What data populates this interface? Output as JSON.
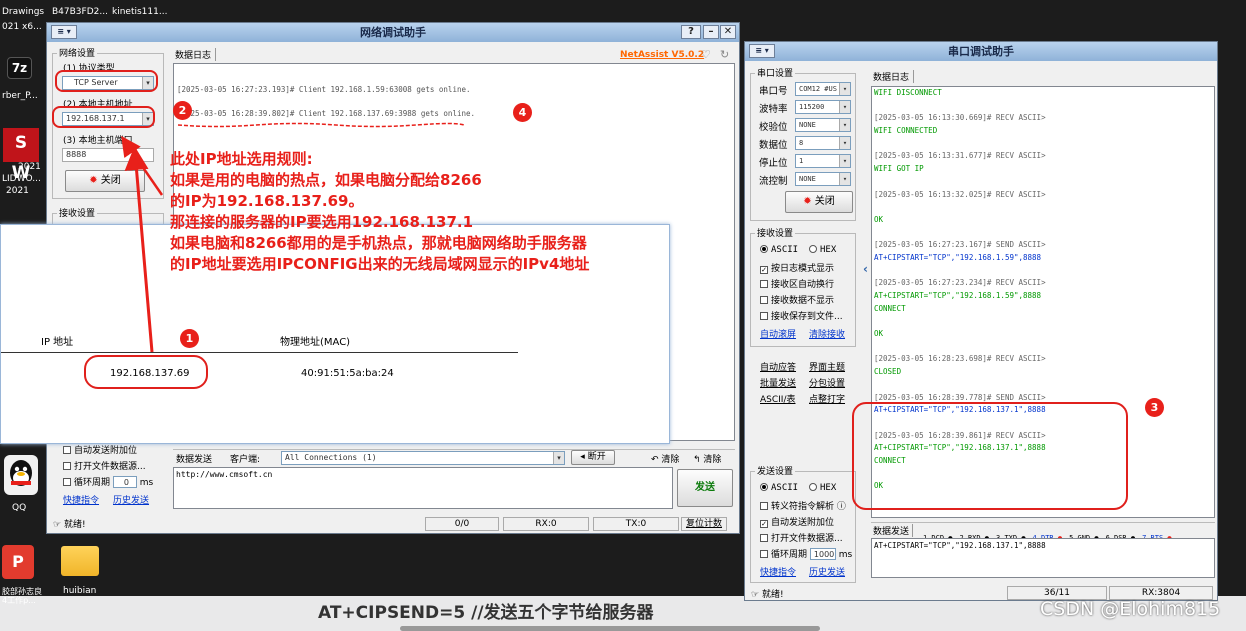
{
  "desktop": {
    "top_items": [
      "Drawings",
      "B47B3FD2...",
      "kinetis111..."
    ],
    "top_sub": "021 x6...",
    "left_icons": [
      {
        "label": "",
        "icon": "7z-icon"
      },
      {
        "label": "rber_P...",
        "icon": ""
      },
      {
        "label": "2021",
        "icon": "solidworks-icon"
      },
      {
        "label": "LIDWO...",
        "icon": ""
      },
      {
        "label": "2021",
        "icon": ""
      },
      {
        "label": "QQ",
        "icon": "qq-icon"
      },
      {
        "label": "胶部孙志良\n4工作p...",
        "icon": "wps-icon"
      },
      {
        "label": "huibian",
        "icon": "folder-icon"
      }
    ],
    "bottom_text": "AT+CIPSEND=5 //发送五个字节给服务器",
    "watermark": "CSDN @Elohim815"
  },
  "net": {
    "title": "网络调试助手",
    "version": "NetAssist V5.0.2",
    "net_settings": "网络设置",
    "proto_label": "(1) 协议类型",
    "proto_value": "TCP Server",
    "local_ip_label": "(2) 本地主机地址",
    "local_ip_value": "192.168.137.1",
    "port_label": "(3) 本地主机端口",
    "port_value": "8888",
    "close_btn": "关闭",
    "recv_settings": "接收设置",
    "log_title": "数据日志",
    "log_lines": [
      "[2025-03-05 16:27:23.193]# Client 192.168.1.59:63008 gets online.",
      "[2025-03-05 16:28:39.802]# Client 192.168.137.69:3988 gets online."
    ],
    "opt_auto_newline": "自动发送附加位",
    "opt_open_file": "打开文件数据源...",
    "opt_loop": "循环周期",
    "loop_value": "0",
    "loop_unit": "ms",
    "link_shortcut": "快捷指令",
    "link_history": "历史发送",
    "send_tab": "数据发送",
    "client_label": "客户端:",
    "client_value": "All Connections (1)",
    "disconnect_btn": "断开",
    "clear_btn1": "清除",
    "clear_btn2": "清除",
    "send_text": "http://www.cmsoft.cn",
    "send_btn": "发送",
    "status_ready": "就绪!",
    "status_count": "0/0",
    "status_rx": "RX:0",
    "status_tx": "TX:0",
    "status_reset": "复位计数"
  },
  "ipconfig": {
    "col_ip": "IP 地址",
    "col_mac": "物理地址(MAC)",
    "ip_value": "192.168.137.69",
    "mac_value": "40:91:51:5a:ba:24"
  },
  "annotation": {
    "lines": [
      "此处IP地址选用规则:",
      "如果是用的电脑的热点，如果电脑分配给8266",
      "的IP为192.168.137.69。",
      "那连接的服务器的IP要选用192.168.137.1",
      "如果电脑和8266都用的是手机热点，那就电脑网络助手服务器",
      "的IP地址要选用IPCONFIG出来的无线局域网显示的IPv4地址"
    ],
    "badges": [
      "1",
      "2",
      "3",
      "4"
    ]
  },
  "serial": {
    "title": "串口调试助手",
    "port_settings": "串口设置",
    "rows": [
      {
        "label": "串口号",
        "value": "COM12 #US"
      },
      {
        "label": "波特率",
        "value": "115200"
      },
      {
        "label": "校验位",
        "value": "NONE"
      },
      {
        "label": "数据位",
        "value": "8"
      },
      {
        "label": "停止位",
        "value": "1"
      },
      {
        "label": "流控制",
        "value": "NONE"
      }
    ],
    "close_btn": "关闭",
    "recv_settings": "接收设置",
    "recv_ascii": "ASCII",
    "recv_hex": "HEX",
    "opt_log_mode": "按日志模式显示",
    "opt_auto_wrap": "接收区自动换行",
    "opt_no_show": "接收数据不显示",
    "opt_save_file": "接收保存到文件...",
    "link_auto_clear": "自动滚屏",
    "link_clear_recv": "清除接收",
    "link_auto_reply": "自动应答",
    "link_theme": "界面主题",
    "link_batch": "批量发送",
    "link_split": "分包设置",
    "link_ascii_code": "ASCII/表",
    "link_typewriter": "点整打字",
    "send_settings": "发送设置",
    "send_ascii": "ASCII",
    "send_hex": "HEX",
    "opt_escape": "转义符指令解析",
    "opt_append": "自动发送附加位",
    "opt_open_file": "打开文件数据源...",
    "opt_loop": "循环周期",
    "loop_value": "1000",
    "loop_unit": "ms",
    "link_shortcut": "快捷指令",
    "link_history": "历史发送",
    "log_title": "数据日志",
    "log": [
      {
        "t": "WIFI DISCONNECT",
        "c": "green"
      },
      {
        "t": "",
        "c": ""
      },
      {
        "t": "[2025-03-05 16:13:30.669]# RECV ASCII>",
        "c": "gray"
      },
      {
        "t": "WIFI CONNECTED",
        "c": "green"
      },
      {
        "t": "",
        "c": ""
      },
      {
        "t": "[2025-03-05 16:13:31.677]# RECV ASCII>",
        "c": "gray"
      },
      {
        "t": "WIFI GOT IP",
        "c": "green"
      },
      {
        "t": "",
        "c": ""
      },
      {
        "t": "[2025-03-05 16:13:32.025]# RECV ASCII>",
        "c": "gray"
      },
      {
        "t": "",
        "c": ""
      },
      {
        "t": "OK",
        "c": "green"
      },
      {
        "t": "",
        "c": ""
      },
      {
        "t": "[2025-03-05 16:27:23.167]# SEND ASCII>",
        "c": "gray"
      },
      {
        "t": "AT+CIPSTART=\"TCP\",\"192.168.1.59\",8888",
        "c": "blue"
      },
      {
        "t": "",
        "c": ""
      },
      {
        "t": "[2025-03-05 16:27:23.234]# RECV ASCII>",
        "c": "gray"
      },
      {
        "t": "AT+CIPSTART=\"TCP\",\"192.168.1.59\",8888",
        "c": "green"
      },
      {
        "t": "CONNECT",
        "c": "green"
      },
      {
        "t": "",
        "c": ""
      },
      {
        "t": "OK",
        "c": "green"
      },
      {
        "t": "",
        "c": ""
      },
      {
        "t": "[2025-03-05 16:28:23.698]# RECV ASCII>",
        "c": "gray"
      },
      {
        "t": "CLOSED",
        "c": "green"
      },
      {
        "t": "",
        "c": ""
      },
      {
        "t": "[2025-03-05 16:28:39.778]# SEND ASCII>",
        "c": "gray"
      },
      {
        "t": "AT+CIPSTART=\"TCP\",\"192.168.137.1\",8888",
        "c": "blue"
      },
      {
        "t": "",
        "c": ""
      },
      {
        "t": "[2025-03-05 16:28:39.861]# RECV ASCII>",
        "c": "gray"
      },
      {
        "t": "AT+CIPSTART=\"TCP\",\"192.168.137.1\",8888",
        "c": "green"
      },
      {
        "t": "CONNECT",
        "c": "green"
      },
      {
        "t": "",
        "c": ""
      },
      {
        "t": "OK",
        "c": "green"
      }
    ],
    "send_tab": "数据发送",
    "pins": [
      "1.DCD",
      "2.RXD",
      "3.TXD",
      "4.DTR",
      "5.GND",
      "6.DSR",
      "7.RTS"
    ],
    "send_text": "AT+CIPSTART=\"TCP\",\"192.168.137.1\",8888",
    "status_ready": "就绪!",
    "status_count": "36/11",
    "status_rx": "RX:3804"
  },
  "colors": {
    "annotation": "#e8201a",
    "version": "#ff6600",
    "link": "#0033cc"
  }
}
